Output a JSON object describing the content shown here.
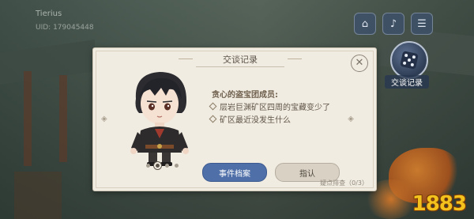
{
  "player": {
    "name": "Tierius",
    "uid": "UID: 179045448"
  },
  "hud": {
    "buttons": [
      {
        "icon": "home-icon",
        "glyph": "⌂"
      },
      {
        "icon": "music-icon",
        "glyph": "♪"
      },
      {
        "icon": "menu-icon",
        "glyph": "☰"
      }
    ],
    "dialog_log_label": "交谈记录"
  },
  "dialog": {
    "title": "交谈记录",
    "speaker": "贪心的盗宝团成员:",
    "lines": [
      "层岩巨渊矿区四周的宝藏变少了",
      "矿区最近没发生什么"
    ],
    "buttons": {
      "events": "事件档案",
      "accuse": "指认"
    },
    "clue_count": "疑点排查（0/3）",
    "page_dots": 4,
    "active_page": 2
  },
  "watermark": "1883",
  "colors": {
    "primary_button": "#4f6fa8",
    "panel_bg": "#f1ece2",
    "watermark": "#f4c21c"
  }
}
